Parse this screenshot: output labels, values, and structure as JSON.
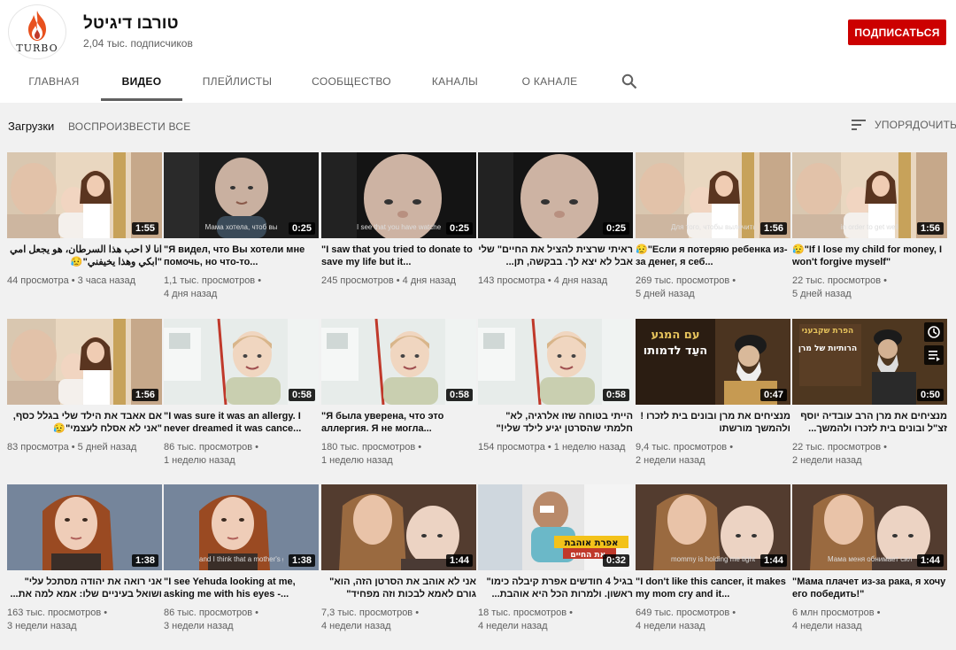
{
  "channel": {
    "name": "טורבו דיגיטל",
    "logo_text": "TURBO",
    "subscribers": "2,04 тыс. подписчиков",
    "subscribe_label": "ПОДПИСАТЬСЯ"
  },
  "tabs": [
    {
      "label": "ГЛАВНАЯ"
    },
    {
      "label": "ВИДЕО"
    },
    {
      "label": "ПЛЕЙЛИСТЫ"
    },
    {
      "label": "СООБЩЕСТВО"
    },
    {
      "label": "КАНАЛЫ"
    },
    {
      "label": "О КАНАЛЕ"
    }
  ],
  "section": {
    "uploads_label": "Загрузки",
    "play_all_label": "ВОСПРОИЗВЕСТИ ВСЕ",
    "sort_label": "УПОРЯДОЧИТЬ"
  },
  "videos": [
    {
      "title": "انا لا احب هذا السرطان، هو يجعل امي \"ابكي وهذا يخيفني\"😥",
      "views": "44 просмотра",
      "age": "3 часа назад",
      "duration": "1:55",
      "rtl": true,
      "subtitle": "",
      "theme": "mom"
    },
    {
      "title": "\"Я видел, что Вы хотели мне помочь, но что-то...",
      "views": "1,1 тыс. просмотров",
      "age": "4 дня назад",
      "duration": "0:25",
      "rtl": false,
      "subtitle": "Мама хотела, чтоб вы",
      "theme": "boy-dark"
    },
    {
      "title": "\"I saw that you tried to donate to save my life but it...",
      "views": "245 просмотров",
      "age": "4 дня назад",
      "duration": "0:25",
      "rtl": false,
      "subtitle": "I see that you have watched my",
      "theme": "boy-dark-close"
    },
    {
      "title": "ראיתי שרצית להציל את החיים\" שלי אבל לא יצא לך. בבקשה, תן...",
      "views": "143 просмотра",
      "age": "4 дня назад",
      "duration": "0:25",
      "rtl": true,
      "subtitle": "",
      "theme": "boy-dark-close"
    },
    {
      "title": "😥\"Если я потеряю ребенка из-за денег, я себ...",
      "views": "269 тыс. просмотров",
      "age": "5 дней назад",
      "duration": "1:56",
      "rtl": false,
      "subtitle": "Для того, чтобы вылечить",
      "theme": "mom"
    },
    {
      "title": "😥\"If I lose my child for money, I won't forgive myself\"",
      "views": "22 тыс. просмотров",
      "age": "5 дней назад",
      "duration": "1:56",
      "rtl": false,
      "subtitle": "in order to get well",
      "theme": "mom"
    },
    {
      "title": "אם אאבד את הילד שלי בגלל כסף, \"אני לא אסלח לעצמי\"😥",
      "views": "83 просмотра",
      "age": "5 дней назад",
      "duration": "1:56",
      "rtl": true,
      "subtitle": "",
      "theme": "mom"
    },
    {
      "title": "\"I was sure it was an allergy. I never dreamed it was cance...",
      "views": "86 тыс. просмотров",
      "age": "1 неделю назад",
      "duration": "0:58",
      "rtl": false,
      "subtitle": "",
      "theme": "hospital"
    },
    {
      "title": "\"Я была уверена, что это аллергия. Я не могла...",
      "views": "180 тыс. просмотров",
      "age": "1 неделю назад",
      "duration": "0:58",
      "rtl": false,
      "subtitle": "",
      "theme": "hospital"
    },
    {
      "title": "הייתי בטוחה שזו אלרגיה, לא\" חלמתי שהסרטן יגיע לילד שלי!\"",
      "views": "154 просмотра",
      "age": "1 неделю назад",
      "duration": "0:58",
      "rtl": true,
      "subtitle": "",
      "theme": "hospital"
    },
    {
      "title": "מנציחים את מרן ובונים בית לזכרו !ולהמשך מורשתו",
      "views": "9,4 тыс. просмотров",
      "age": "2 недели назад",
      "duration": "0:47",
      "rtl": true,
      "subtitle": "",
      "theme": "rabbi"
    },
    {
      "title": "מנציחים את מרן הרב עובדיה יוסף זצ\"ל ובונים בית לזכרו ולהמשך...",
      "views": "22 тыс. просмотров",
      "age": "2 недели назад",
      "duration": "0:50",
      "rtl": true,
      "subtitle": "",
      "theme": "rabbi2"
    },
    {
      "title": "אני רואה את יהודה מסתכל עלי\" ושואל בעיניים שלו: אמא למה את...",
      "views": "163 тыс. просмотров",
      "age": "3 недели назад",
      "duration": "1:38",
      "rtl": true,
      "subtitle": "",
      "theme": "woman"
    },
    {
      "title": "\"I see Yehuda looking at me, asking me with his eyes -...",
      "views": "86 тыс. просмотров",
      "age": "3 недели назад",
      "duration": "1:38",
      "rtl": false,
      "subtitle": "and I think that a mother's greatest",
      "theme": "woman"
    },
    {
      "title": "אני לא אוהב את הסרטן הזה, הוא\" גורם לאמא לבכות וזה מפחיד\"",
      "views": "7,3 тыс. просмотров",
      "age": "4 недели назад",
      "duration": "1:44",
      "rtl": true,
      "subtitle": "",
      "theme": "hug"
    },
    {
      "title": "בגיל 4 חודשים אפרת קיבלה כימו\" ראשון. ולמרות הכל היא אוהבת...",
      "views": "18 тыс. просмотров",
      "age": "4 недели назад",
      "duration": "0:32",
      "rtl": true,
      "subtitle": "",
      "theme": "baby"
    },
    {
      "title": "\"I don't like this cancer, it makes my mom cry and it...",
      "views": "649 тыс. просмотров",
      "age": "4 недели назад",
      "duration": "1:44",
      "rtl": false,
      "subtitle": "mommy is holding me tight",
      "theme": "hug"
    },
    {
      "title": "\"Мама плачет из-за рака, я хочу его победить!\"",
      "views": "6 млн просмотров",
      "age": "4 недели назад",
      "duration": "1:44",
      "rtl": false,
      "subtitle": "Мама меня обнимает сильно-сил",
      "theme": "hug"
    }
  ],
  "thumb_overlays": {
    "rabbi_line1": "עם המגע",
    "rabbi_line2": "העֵד לדמותו",
    "rabbi2_line1": "הפרת שקבעני",
    "rabbi2_line2": "הרותיות של מרן",
    "baby_line1": "אפרת אוהבת",
    "baby_line2": "את החיים."
  },
  "colors": {
    "subscribe": "#cc0000",
    "background": "#f1f1f1",
    "header": "#ffffff"
  }
}
